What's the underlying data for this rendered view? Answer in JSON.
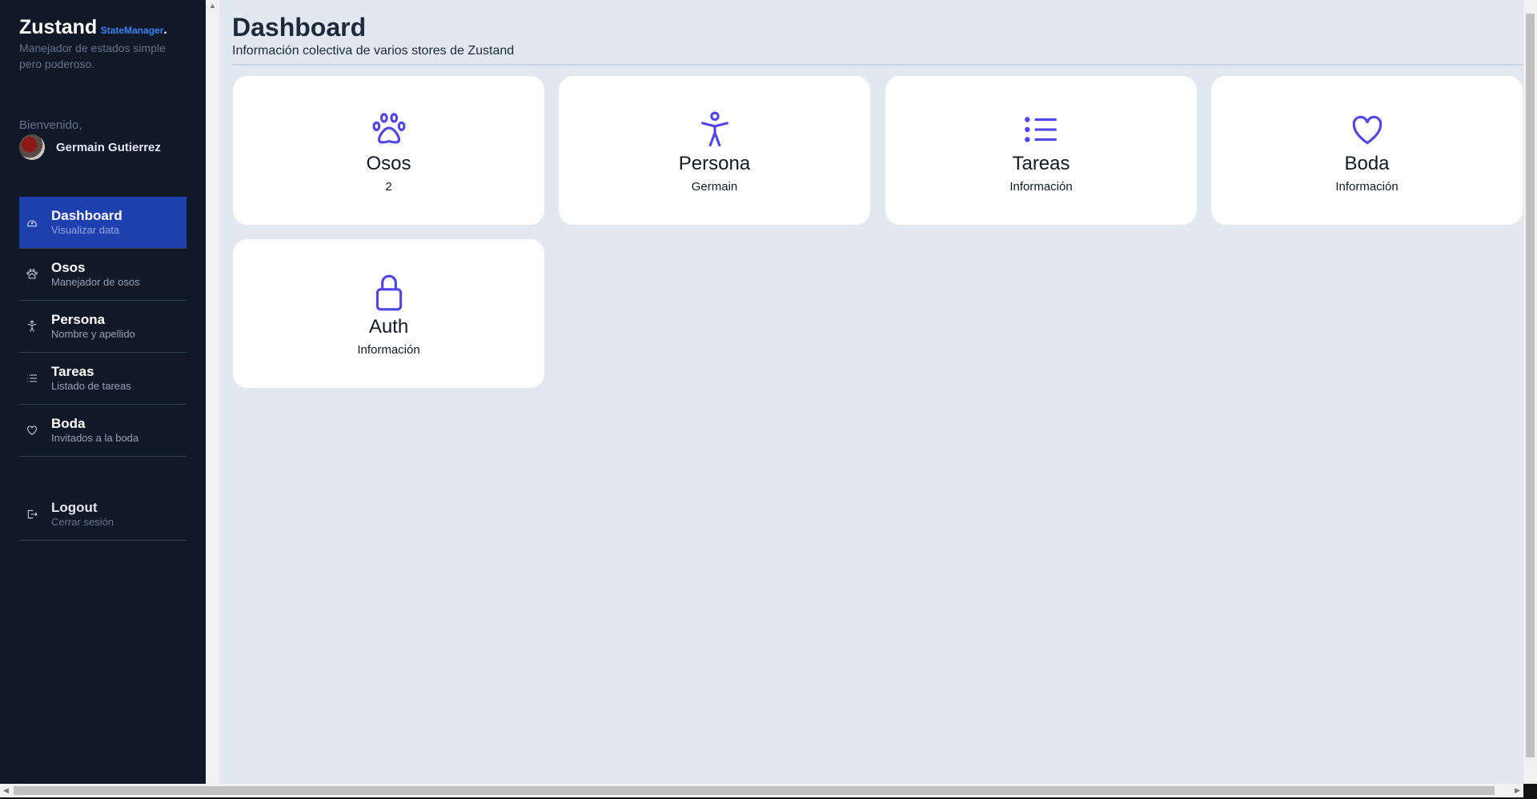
{
  "brand": {
    "name": "Zustand",
    "sub": "StateManager",
    "dot": ".",
    "tagline": "Manejador de estados simple pero poderoso."
  },
  "user": {
    "greeting": "Bienvenido,",
    "name": "Germain Gutierrez"
  },
  "nav": [
    {
      "title": "Dashboard",
      "desc": "Visualizar data",
      "icon": "dashboard-gauge-icon"
    },
    {
      "title": "Osos",
      "desc": "Manejador de osos",
      "icon": "paw-icon"
    },
    {
      "title": "Persona",
      "desc": "Nombre y apellido",
      "icon": "person-icon"
    },
    {
      "title": "Tareas",
      "desc": "Listado de tareas",
      "icon": "list-icon"
    },
    {
      "title": "Boda",
      "desc": "Invitados a la boda",
      "icon": "heart-icon"
    }
  ],
  "logout": {
    "title": "Logout",
    "desc": "Cerrar sesión",
    "icon": "logout-icon"
  },
  "header": {
    "title": "Dashboard",
    "subtitle": "Información colectiva de varios stores de Zustand"
  },
  "cards": [
    {
      "title": "Osos",
      "value": "2",
      "icon": "paw-icon"
    },
    {
      "title": "Persona",
      "value": "Germain",
      "icon": "person-icon"
    },
    {
      "title": "Tareas",
      "value": "Información",
      "icon": "list-icon"
    },
    {
      "title": "Boda",
      "value": "Información",
      "icon": "heart-icon"
    },
    {
      "title": "Auth",
      "value": "Información",
      "icon": "lock-icon"
    }
  ],
  "colors": {
    "sidebar": "#111827",
    "active": "#1e40af",
    "accent": "#4f46e5",
    "background": "#e2e8f0"
  }
}
